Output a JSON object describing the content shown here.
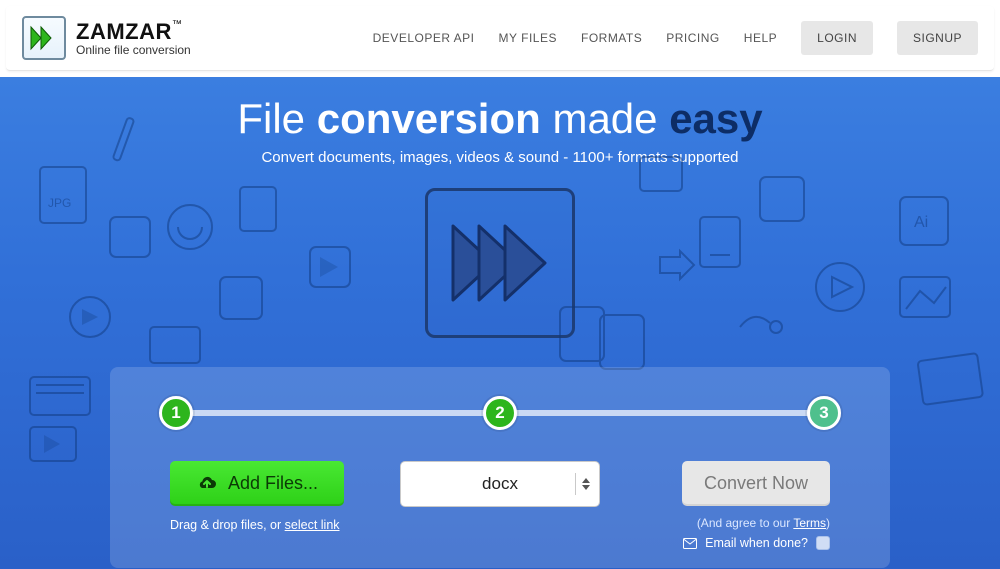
{
  "brand": {
    "name": "ZAMZAR",
    "tm": "™",
    "tagline": "Online file conversion"
  },
  "nav": {
    "developer_api": "DEVELOPER API",
    "my_files": "MY FILES",
    "formats": "FORMATS",
    "pricing": "PRICING",
    "help": "HELP",
    "login": "LOGIN",
    "signup": "SIGNUP"
  },
  "hero": {
    "title_pre": "File ",
    "title_bold1": "conversion",
    "title_mid": " made ",
    "title_bold2": "easy",
    "subtitle": "Convert documents, images, videos & sound - 1100+ formats supported"
  },
  "converter": {
    "step1": "1",
    "step2": "2",
    "step3": "3",
    "add_files_label": "Add Files...",
    "drag_hint_pre": "Drag & drop files, or ",
    "drag_hint_link": "select link",
    "format_selected": "docx",
    "convert_label": "Convert Now",
    "terms_pre": "(And agree to our ",
    "terms_link": "Terms",
    "terms_post": ")",
    "email_label": "Email when done?"
  }
}
